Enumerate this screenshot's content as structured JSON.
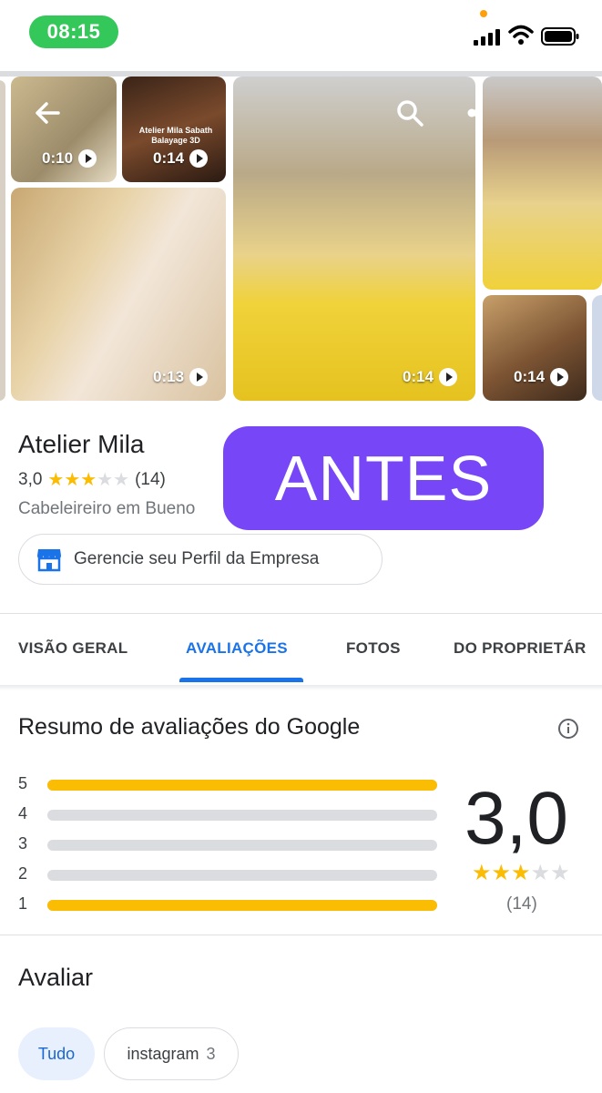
{
  "status_bar": {
    "time": "08:15"
  },
  "media": {
    "tiles": [
      {
        "duration": "0:10"
      },
      {
        "caption": "Atelier Mila Sabath\nBalayage 3D",
        "duration": "0:14"
      },
      {
        "duration": "0:13"
      },
      {
        "duration": "0:14"
      },
      {
        "duration": "0:14"
      }
    ]
  },
  "business": {
    "name": "Atelier Mila",
    "rating": "3,0",
    "rating_stars": 3,
    "review_count": "(14)",
    "category": "Cabeleireiro em Bueno"
  },
  "manage_button": {
    "label": "Gerencie seu Perfil da Empresa"
  },
  "banner": {
    "text": "ANTES"
  },
  "tabs": [
    {
      "label": "VISÃO GERAL"
    },
    {
      "label": "AVALIAÇÕES"
    },
    {
      "label": "FOTOS"
    },
    {
      "label": "DO PROPRIETÁR"
    }
  ],
  "summary": {
    "title": "Resumo de avaliações do Google",
    "distribution": [
      {
        "stars": "5",
        "fraction": 1.0
      },
      {
        "stars": "4",
        "fraction": 0.0
      },
      {
        "stars": "3",
        "fraction": 0.0
      },
      {
        "stars": "2",
        "fraction": 0.0
      },
      {
        "stars": "1",
        "fraction": 1.0
      }
    ],
    "average": "3,0",
    "average_stars": 3,
    "count": "(14)"
  },
  "reviews_filter": {
    "title": "Avaliar",
    "chips": [
      {
        "label": "Tudo"
      },
      {
        "label": "instagram",
        "count": "3"
      }
    ]
  },
  "colors": {
    "accent": "#1a73e8",
    "star": "#fbbc04",
    "banner": "#7747f7",
    "time_pill": "#34c759"
  }
}
